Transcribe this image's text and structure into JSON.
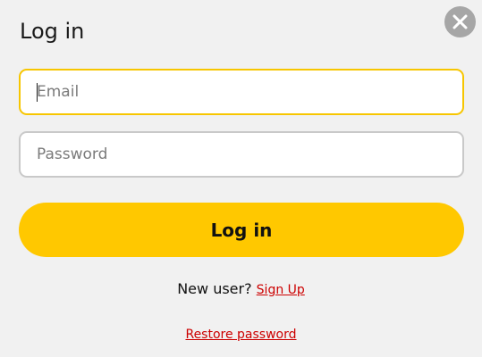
{
  "dialog": {
    "title": "Log in",
    "close_icon": "close-icon"
  },
  "form": {
    "email": {
      "placeholder": "Email",
      "value": ""
    },
    "password": {
      "placeholder": "Password",
      "value": ""
    },
    "submit_label": "Log in"
  },
  "footer": {
    "new_user_text": "New user?",
    "signup_label": "Sign Up",
    "restore_label": "Restore password"
  },
  "colors": {
    "background": "#f1f1f1",
    "accent": "#ffc800",
    "focus_border": "#f7c600",
    "link": "#cc0000",
    "close_button": "#a6a6a6"
  }
}
